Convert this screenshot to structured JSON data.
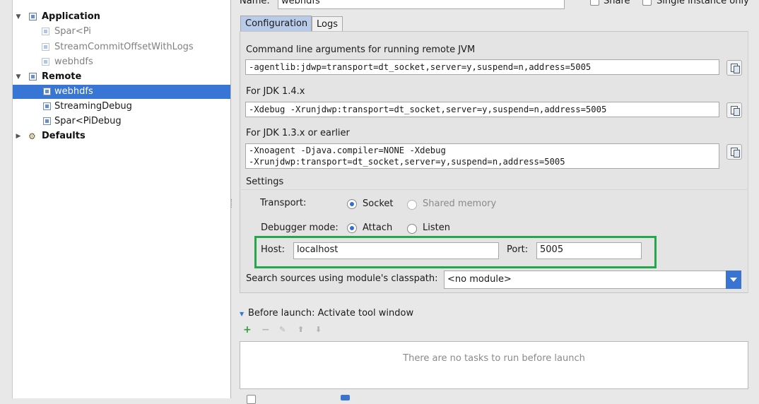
{
  "tree": {
    "items": [
      {
        "label": "Application",
        "kind": "group",
        "expanded": true
      },
      {
        "label": "Spar<Pi",
        "kind": "child-dim"
      },
      {
        "label": "StreamCommitOffsetWithLogs",
        "kind": "child-dim"
      },
      {
        "label": "webhdfs",
        "kind": "child-dim"
      },
      {
        "label": "Remote",
        "kind": "group",
        "expanded": true
      },
      {
        "label": "webhdfs",
        "kind": "child",
        "selected": true
      },
      {
        "label": "StreamingDebug",
        "kind": "child"
      },
      {
        "label": "Spar<PiDebug",
        "kind": "child"
      },
      {
        "label": "Defaults",
        "kind": "group",
        "expanded": false
      }
    ]
  },
  "header": {
    "name_label": "Name:",
    "name_value": "webhdfs",
    "share_label": "Share",
    "single_instance_label": "Single instance only"
  },
  "tabs": [
    {
      "label": "Configuration",
      "active": true
    },
    {
      "label": "Logs",
      "active": false
    }
  ],
  "config": {
    "cmdline_label": "Command line arguments for running remote JVM",
    "cmdline_value": "-agentlib:jdwp=transport=dt_socket,server=y,suspend=n,address=5005",
    "jdk14_label": "For JDK 1.4.x",
    "jdk14_value": "-Xdebug -Xrunjdwp:transport=dt_socket,server=y,suspend=n,address=5005",
    "jdk13_label": "For JDK 1.3.x or earlier",
    "jdk13_line1": "-Xnoagent -Djava.compiler=NONE -Xdebug",
    "jdk13_line2": "-Xrunjdwp:transport=dt_socket,server=y,suspend=n,address=5005"
  },
  "settings": {
    "title": "Settings",
    "transport_label": "Transport:",
    "transport_options": [
      {
        "label": "Socket",
        "selected": true
      },
      {
        "label": "Shared memory",
        "selected": false,
        "disabled": true
      }
    ],
    "debugger_mode_label": "Debugger mode:",
    "debugger_options": [
      {
        "label": "Attach",
        "selected": true
      },
      {
        "label": "Listen",
        "selected": false
      }
    ],
    "host_label": "Host:",
    "host_value": "localhost",
    "port_label": "Port:",
    "port_value": "5005",
    "search_sources_label": "Search sources using module's classpath:",
    "module_value": "<no module>"
  },
  "before_launch": {
    "title": "Before launch: Activate tool window",
    "empty_text": "There are no tasks to run before launch"
  },
  "colors": {
    "selection": "#3876d6",
    "highlight_border": "#22a84a",
    "radio_dot": "#2f6fd0",
    "add_green": "#2f9e3a"
  }
}
